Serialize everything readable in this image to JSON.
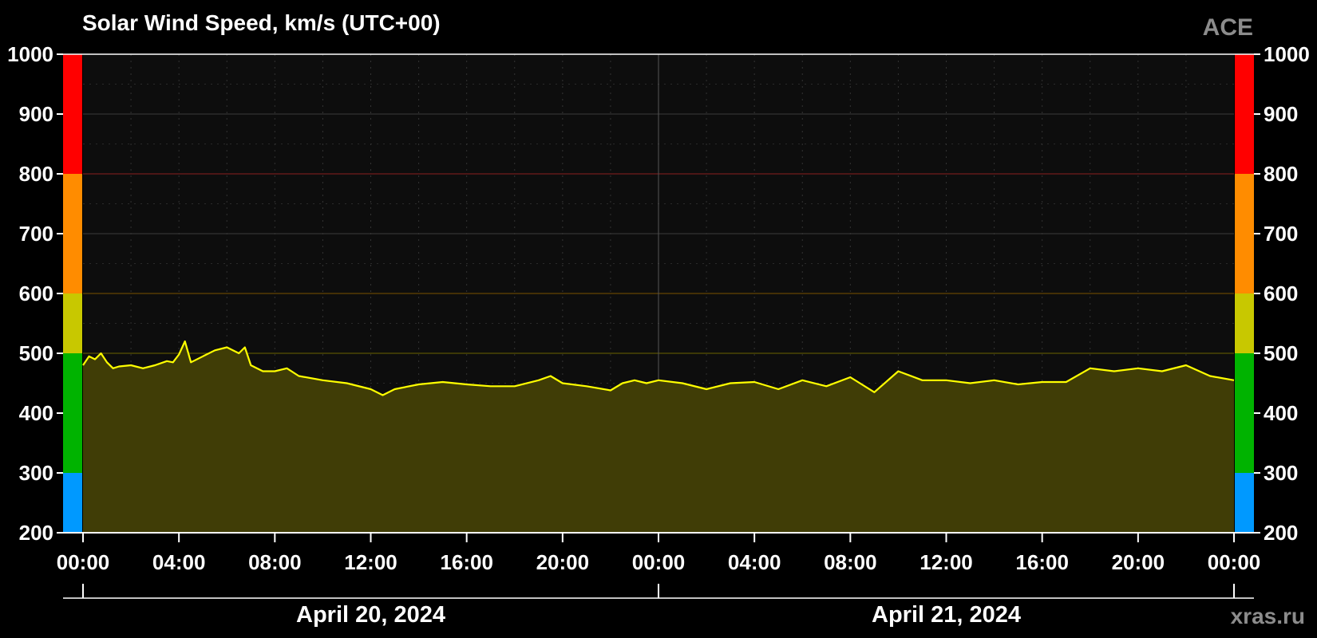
{
  "chart_data": {
    "type": "area",
    "title": "Solar Wind Speed, km/s (UTC+00)",
    "source_label": "ACE",
    "credit": "xras.ru",
    "ylim": [
      200,
      1000
    ],
    "y_ticks": [
      "200",
      "300",
      "400",
      "500",
      "600",
      "700",
      "800",
      "900",
      "1000"
    ],
    "x_tick_labels": [
      "00:00",
      "04:00",
      "08:00",
      "12:00",
      "16:00",
      "20:00",
      "00:00",
      "04:00",
      "08:00",
      "12:00",
      "16:00",
      "20:00",
      "00:00"
    ],
    "x_range_hours": [
      0,
      48
    ],
    "dates": [
      "April 20, 2024",
      "April 21, 2024"
    ],
    "grid": true,
    "colors": {
      "series_line": "#ffff00",
      "series_fill": "#403d06",
      "plot_bg": "#0d0d0d",
      "level_blue": "#0099ff",
      "level_green": "#00b300",
      "level_yellow": "#c8c800",
      "level_orange": "#ff8c00",
      "level_red": "#ff0000"
    },
    "level_bands": [
      {
        "from": 200,
        "to": 300,
        "color": "#0099ff"
      },
      {
        "from": 300,
        "to": 500,
        "color": "#00b300"
      },
      {
        "from": 500,
        "to": 600,
        "color": "#c8c800"
      },
      {
        "from": 600,
        "to": 800,
        "color": "#ff8c00"
      },
      {
        "from": 800,
        "to": 1000,
        "color": "#ff0000"
      }
    ],
    "series": [
      {
        "hours": [
          0,
          0.25,
          0.5,
          0.75,
          1,
          1.25,
          1.5,
          2,
          2.5,
          3,
          3.5,
          3.75,
          4,
          4.25,
          4.5,
          5,
          5.5,
          6,
          6.5,
          6.75,
          7,
          7.5,
          8,
          8.5,
          9,
          10,
          11,
          12,
          12.5,
          13,
          14,
          15,
          16,
          17,
          18,
          19,
          19.5,
          20,
          21,
          22,
          22.5,
          23,
          23.5,
          24,
          25,
          26,
          27,
          28,
          29,
          30,
          31,
          32,
          33,
          34,
          35,
          36,
          37,
          38,
          39,
          40,
          41,
          42,
          43,
          44,
          45,
          46,
          47,
          48
        ],
        "values": [
          480,
          495,
          490,
          500,
          485,
          475,
          478,
          480,
          475,
          480,
          487,
          485,
          498,
          520,
          485,
          495,
          505,
          510,
          500,
          510,
          480,
          470,
          470,
          475,
          462,
          455,
          450,
          440,
          430,
          440,
          448,
          452,
          448,
          445,
          445,
          455,
          462,
          450,
          445,
          438,
          450,
          455,
          450,
          455,
          450,
          440,
          450,
          452,
          440,
          455,
          445,
          460,
          435,
          470,
          455,
          455,
          450,
          455,
          448,
          452,
          452,
          475,
          470,
          475,
          470,
          480,
          462,
          455
        ]
      }
    ]
  }
}
